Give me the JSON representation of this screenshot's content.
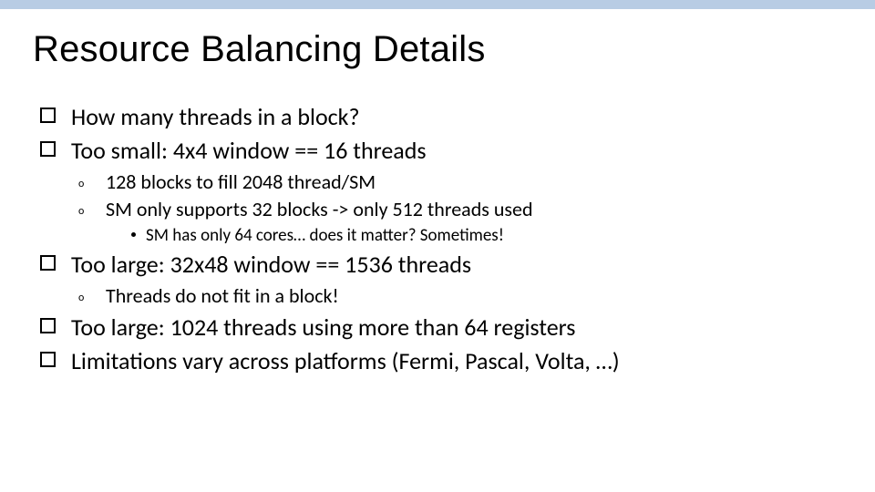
{
  "slide": {
    "title": "Resource Balancing Details",
    "b1": "How many threads in a block?",
    "b2": "Too small: 4x4 window == 16 threads",
    "b2a": "128 blocks to fill 2048 thread/SM",
    "b2b": "SM only supports 32 blocks -> only 512 threads used",
    "b2b1": "SM has only 64 cores… does it matter? Sometimes!",
    "b3": "Too large: 32x48 window == 1536 threads",
    "b3a": "Threads do not fit in a block!",
    "b4": "Too large: 1024 threads using more than 64 registers",
    "b5": "Limitations vary across platforms (Fermi, Pascal, Volta, …)"
  }
}
